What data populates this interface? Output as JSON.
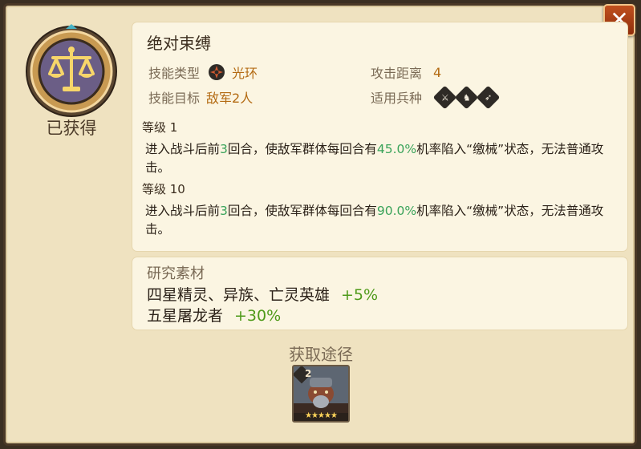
{
  "dialog": {
    "close_label": "✕"
  },
  "status": {
    "acquired_label": "已获得"
  },
  "skill": {
    "name": "绝对束缚",
    "type_label": "技能类型",
    "type_value": "光环",
    "range_label": "攻击距离",
    "range_value": "4",
    "target_label": "技能目标",
    "target_value": "敌军2人",
    "troop_label": "适用兵种",
    "troop_icons": [
      "sword-icon",
      "horse-icon",
      "bow-icon"
    ],
    "levels": [
      {
        "label": "等级 1",
        "pre": "进入战斗后前",
        "turns": "3",
        "mid": "回合，使敌军群体每回合有",
        "chance": "45.0%",
        "post": "机率陷入“缴械”状态，无法普通攻击。"
      },
      {
        "label": "等级 10",
        "pre": "进入战斗后前",
        "turns": "3",
        "mid": "回合，使敌军群体每回合有",
        "chance": "90.0%",
        "post": "机率陷入“缴械”状态，无法普通攻击。"
      }
    ]
  },
  "materials": {
    "title": "研究素材",
    "rows": [
      {
        "text": "四星精灵、异族、亡灵英雄",
        "bonus": "+5%"
      },
      {
        "text": "五星屠龙者",
        "bonus": "+30%"
      }
    ]
  },
  "source": {
    "title": "获取途径",
    "hero_card": {
      "level_badge": "2",
      "stars": "★★★★★"
    }
  },
  "colors": {
    "accent_green": "#3aa35a",
    "value_orange": "#b36a12",
    "bonus_green": "#4f9a1a"
  }
}
